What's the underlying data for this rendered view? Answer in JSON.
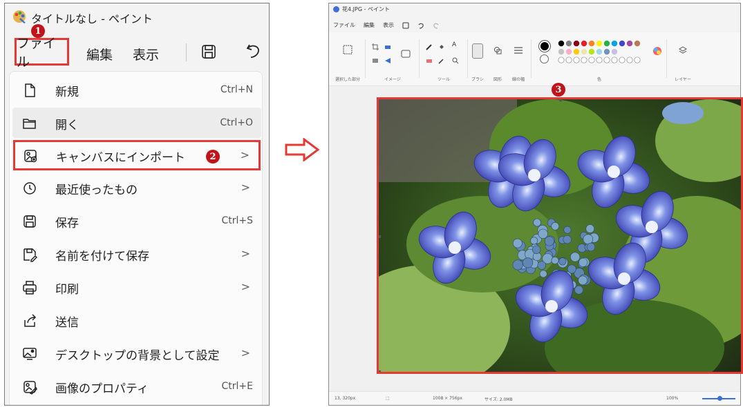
{
  "left_panel": {
    "title": "タイトルなし - ペイント",
    "menubar": {
      "file": "ファイル",
      "edit": "編集",
      "view": "表示"
    },
    "badge_1": "1",
    "file_menu": [
      {
        "label": "新規",
        "shortcut": "Ctrl+N",
        "icon": "new-file-icon"
      },
      {
        "label": "開く",
        "shortcut": "Ctrl+O",
        "icon": "folder-open-icon"
      },
      {
        "label": "キャンバスにインポート",
        "arrow": ">",
        "icon": "import-image-icon",
        "badge": "2"
      },
      {
        "label": "最近使ったもの",
        "arrow": ">",
        "icon": "clock-icon"
      },
      {
        "label": "保存",
        "shortcut": "Ctrl+S",
        "icon": "save-icon"
      },
      {
        "label": "名前を付けて保存",
        "arrow": ">",
        "icon": "save-as-icon"
      },
      {
        "label": "印刷",
        "arrow": ">",
        "icon": "printer-icon"
      },
      {
        "label": "送信",
        "icon": "share-icon"
      },
      {
        "label": "デスクトップの背景として設定",
        "arrow": ">",
        "icon": "desktop-background-icon"
      },
      {
        "label": "画像のプロパティ",
        "shortcut": "Ctrl+E",
        "icon": "image-properties-icon"
      }
    ]
  },
  "right_panel": {
    "title": "花4.JPG - ペイント",
    "menubar": {
      "file": "ファイル",
      "edit": "編集",
      "view": "表示"
    },
    "ribbon_groups": [
      "選択した部分",
      "イメージ",
      "ツール",
      "ブラシ",
      "図形",
      "線の幅",
      "色",
      "レイヤー"
    ],
    "badge_3": "3",
    "status": {
      "cursor": "13, 320px",
      "image_size": "1008 × 756px",
      "file_size": "サイズ: 2.0MB",
      "zoom": "100%"
    }
  },
  "colors": {
    "highlight_red": "#e53935",
    "badge_red": "#c0141a",
    "palette": [
      "#000000",
      "#7f7f7f",
      "#880015",
      "#ed1c24",
      "#ff7f27",
      "#fff200",
      "#22b14c",
      "#00a2e8",
      "#3f48cc",
      "#a349a4",
      "#b97a57"
    ],
    "palette_row2": [
      "#c3c3c3",
      "#ffaec9",
      "#ffc90e",
      "#efe4b0",
      "#b5e61d",
      "#99d9ea",
      "#7092be",
      "#c8bfe7"
    ]
  }
}
